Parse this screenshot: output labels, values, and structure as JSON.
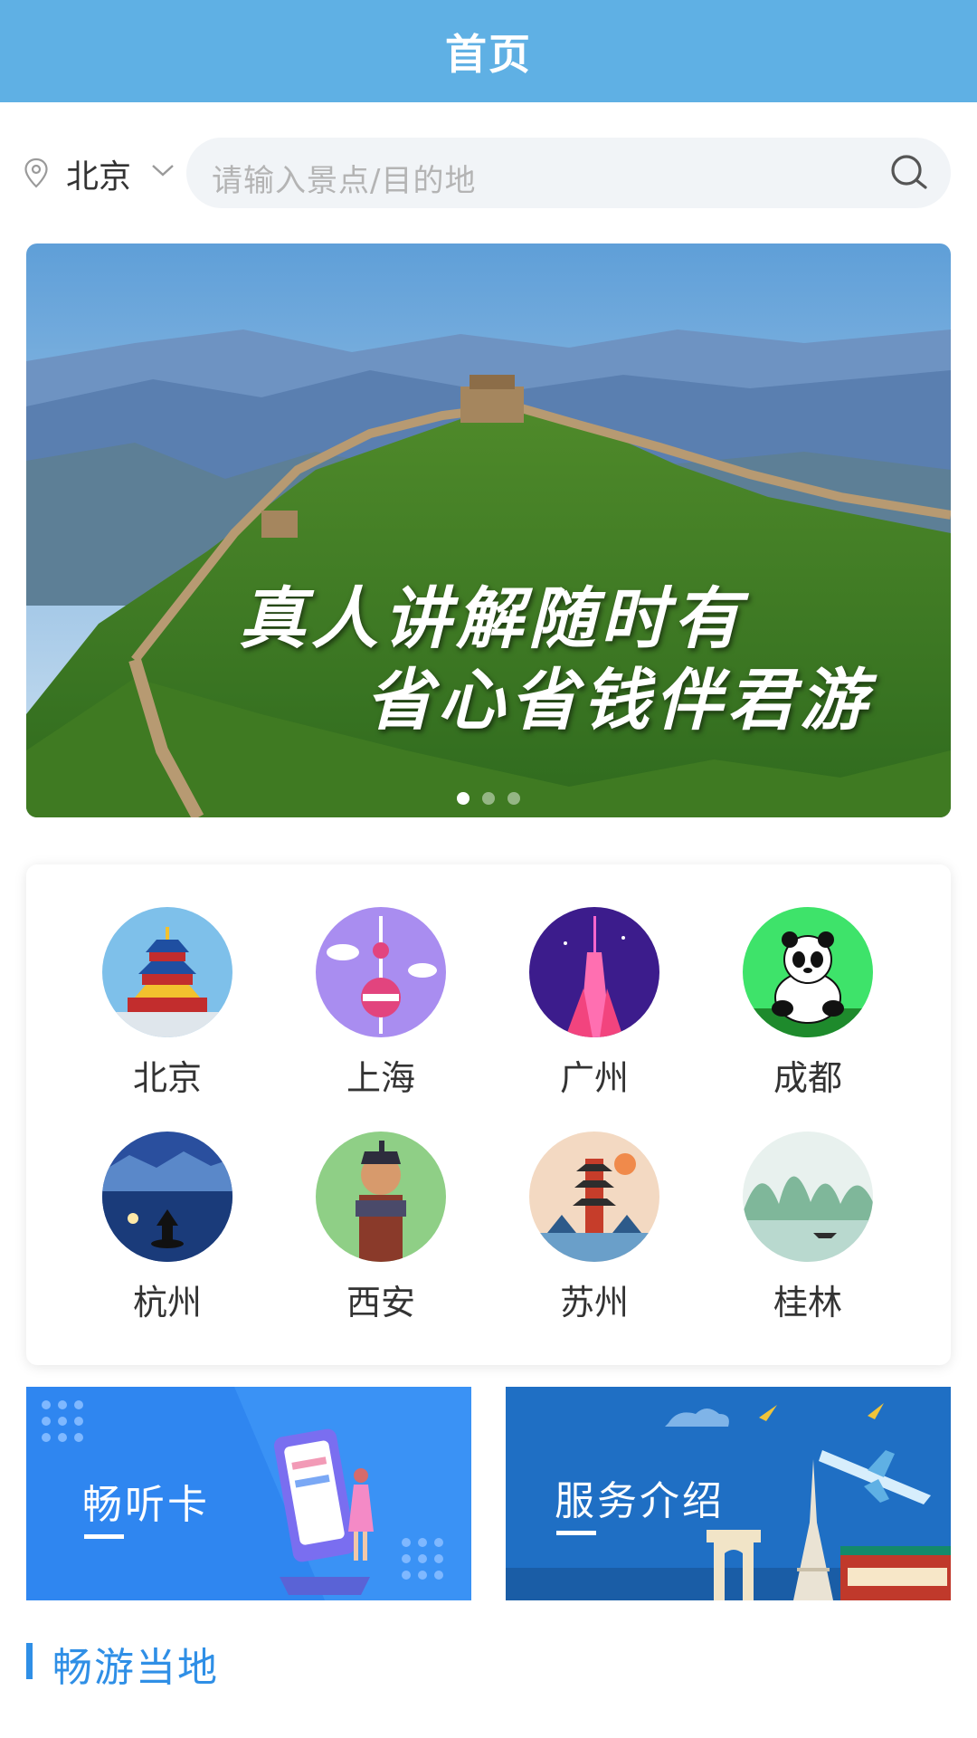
{
  "header": {
    "title": "首页"
  },
  "search": {
    "city": "北京",
    "placeholder": "请输入景点/目的地"
  },
  "banner": {
    "line1": "真人讲解随时有",
    "line2": "省心省钱伴君游",
    "slide_count": 3,
    "active_slide": 1
  },
  "cities": [
    {
      "name": "北京",
      "icon": "temple-of-heaven-icon"
    },
    {
      "name": "上海",
      "icon": "oriental-pearl-tower-icon"
    },
    {
      "name": "广州",
      "icon": "canton-tower-icon"
    },
    {
      "name": "成都",
      "icon": "panda-icon"
    },
    {
      "name": "杭州",
      "icon": "west-lake-pagoda-icon"
    },
    {
      "name": "西安",
      "icon": "terracotta-warrior-icon"
    },
    {
      "name": "苏州",
      "icon": "suzhou-pagoda-icon"
    },
    {
      "name": "桂林",
      "icon": "guilin-karst-icon"
    }
  ],
  "promos": [
    {
      "label": "畅听卡",
      "color": "#2f86f0"
    },
    {
      "label": "服务介绍",
      "color": "#1f6fc4"
    }
  ],
  "section": {
    "title": "畅游当地"
  },
  "colors": {
    "header": "#5fb0e4",
    "accent": "#2f8fe6"
  }
}
